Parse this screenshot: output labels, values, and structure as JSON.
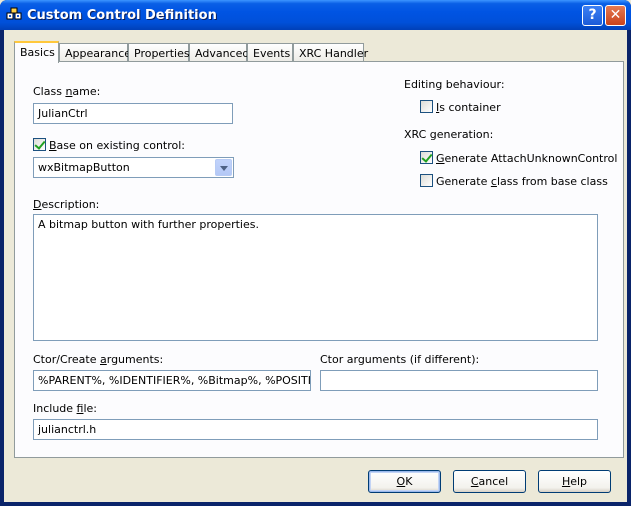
{
  "window": {
    "title": "Custom Control Definition",
    "help_glyph": "?",
    "close_glyph": "✕"
  },
  "tabs": [
    {
      "label": "Basics"
    },
    {
      "label": "Appearance"
    },
    {
      "label": "Properties"
    },
    {
      "label": "Advanced"
    },
    {
      "label": "Events"
    },
    {
      "label": "XRC Handler"
    }
  ],
  "basics": {
    "class_name_label_pre": "Class ",
    "class_name_label_accel": "n",
    "class_name_label_post": "ame:",
    "class_name_value": "JulianCtrl",
    "base_checkbox_checked": true,
    "base_label_accel": "B",
    "base_label_post": "ase on existing control:",
    "base_control_value": "wxBitmapButton",
    "editing_label": "Editing behaviour:",
    "is_container_checked": false,
    "is_container_accel": "I",
    "is_container_post": "s container",
    "xrc_label": "XRC generation:",
    "gen_attach_checked": true,
    "gen_attach_accel": "G",
    "gen_attach_post": "enerate AttachUnknownControl",
    "gen_class_checked": false,
    "gen_class_pre": "Generate ",
    "gen_class_accel": "c",
    "gen_class_post": "lass from base class",
    "description_accel": "D",
    "description_post": "escription:",
    "description_value": "A bitmap button with further properties.",
    "ctor_label_pre": "Ctor/Create ",
    "ctor_label_accel": "a",
    "ctor_label_post": "rguments:",
    "ctor_value": "%PARENT%, %IDENTIFIER%, %Bitmap%, %POSITION",
    "ctor_diff_label": "Ctor arguments (if different):",
    "ctor_diff_value": "",
    "include_label_pre": "Include ",
    "include_label_accel": "f",
    "include_label_post": "ile:",
    "include_value": "julianctrl.h"
  },
  "buttons": {
    "ok_accel": "O",
    "ok_post": "K",
    "cancel_accel": "C",
    "cancel_post": "ancel",
    "help_accel": "H",
    "help_post": "elp"
  }
}
